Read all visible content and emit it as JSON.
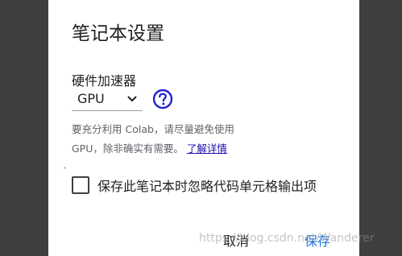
{
  "dialog": {
    "title": "笔记本设置",
    "hardware_accelerator_label": "硬件加速器",
    "hardware_accelerator_value": "GPU",
    "note_line1": "要充分利用 Colab，请尽量避免使用",
    "note_line2_prefix": "GPU，除非确实有需要。",
    "learn_more_link": "了解详情",
    "omit_output_checkbox_label": "保存此笔记本时忽略代码单元格输出项",
    "omit_output_checked": false,
    "cancel_label": "取消",
    "save_label": "保存"
  },
  "watermark": "https://blog.csdn.net/Wanderer",
  "colors": {
    "accent": "#1a73e8",
    "help_icon": "#2323d3",
    "link": "#1a0dab"
  },
  "icons": {
    "select": "chevron-down-icon",
    "help": "question-circle-icon"
  }
}
